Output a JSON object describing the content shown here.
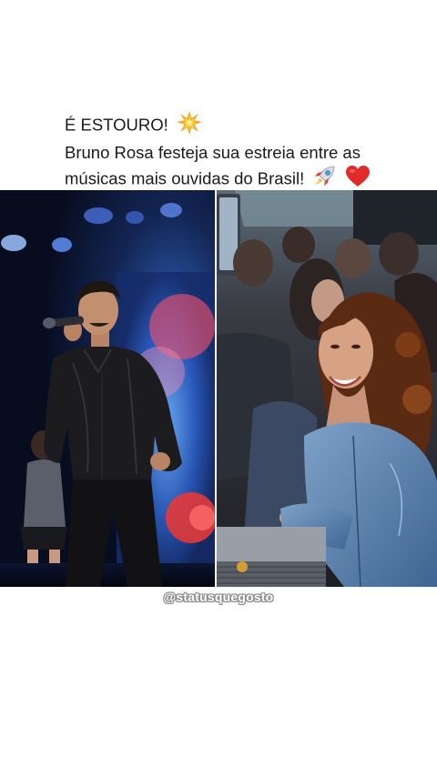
{
  "post": {
    "caption_line1": "É ESTOURO!",
    "caption_line2": "Bruno Rosa festeja sua estreia entre as",
    "caption_line3": "músicas mais ouvidas do Brasil!",
    "emoji_1": "collision-icon",
    "emoji_2": "rocket-icon",
    "emoji_3": "red-heart-icon"
  },
  "media": {
    "left_panel": "singer performing on stage with microphone",
    "right_panel": "smiling woman in the crowd"
  },
  "watermark": "@statusquegosto"
}
